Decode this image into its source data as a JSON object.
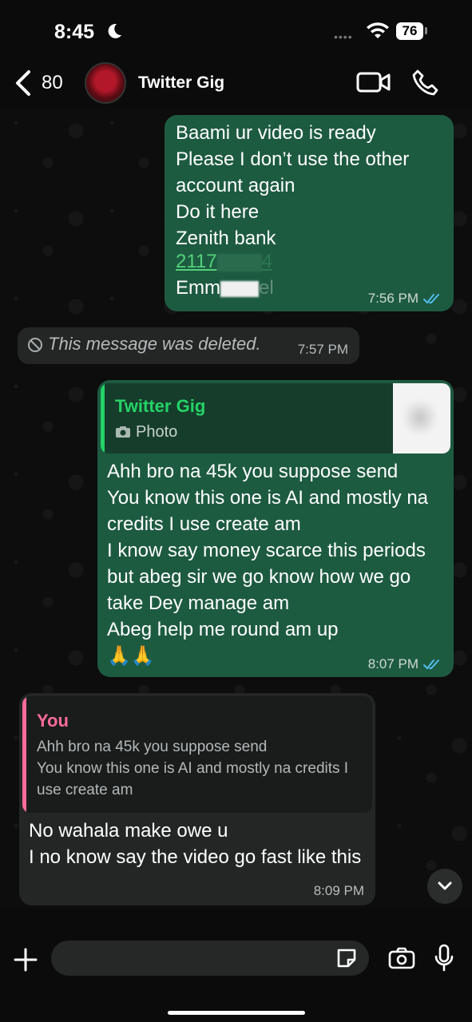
{
  "status_bar": {
    "time": "8:45",
    "battery": "76"
  },
  "header": {
    "back_count": "80",
    "contact_name": "Twitter Gig"
  },
  "messages": {
    "m1": {
      "text": "Baami ur video is ready\nPlease I don’t use the other account again\nDo it here\nZenith bank",
      "account_visible": "2117",
      "account_tail": "4",
      "name_visible": "Emm",
      "name_tail": "el",
      "time": "7:56 PM"
    },
    "m2": {
      "text": "This message was deleted.",
      "time": "7:57 PM"
    },
    "m3": {
      "reply_author": "Twitter Gig",
      "reply_type": "Photo",
      "text": "Ahh bro na 45k you suppose send\nYou know this one is AI and mostly na credits I use create am\nI know say money scarce this periods  but abeg sir we go know how we go take Dey manage am\nAbeg help me round am up\n🙏🙏",
      "time": "8:07 PM"
    },
    "m4": {
      "reply_author": "You",
      "reply_text": "Ahh bro na 45k you suppose send\nYou know this one is AI and mostly na credits I use create am",
      "text": "No wahala make owe u\nI no know say the video go fast like this",
      "time": "8:09 PM"
    }
  },
  "input": {
    "value": "",
    "placeholder": ""
  },
  "colors": {
    "outgoing_bubble": "#1d5b41",
    "incoming_bubble": "#242626",
    "read_ticks": "#53bdeb",
    "quote_green": "#25d366",
    "quote_pink": "#ff6b9a"
  }
}
